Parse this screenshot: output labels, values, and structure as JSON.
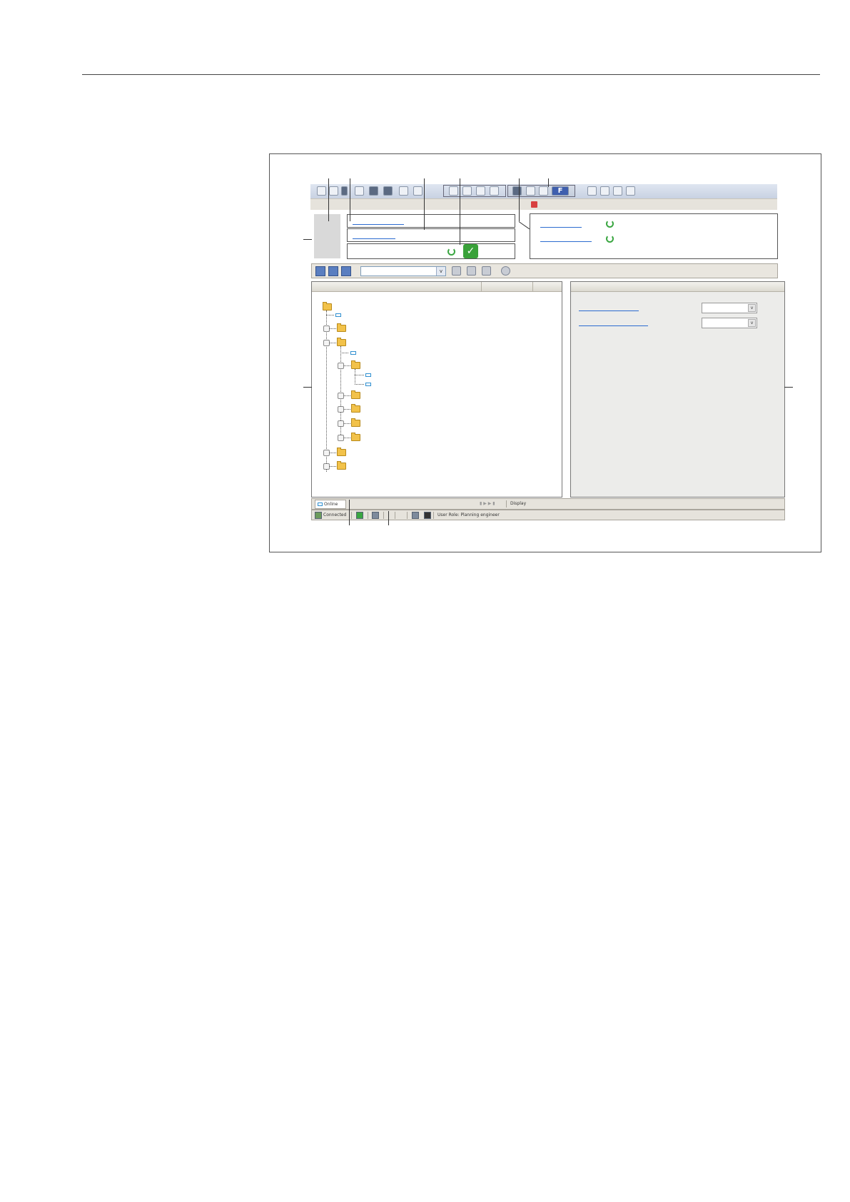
{
  "figure": {
    "tab_online": "Online",
    "status_connected": "Connected",
    "status_user_role": "User Role: Planning engineer",
    "tab_display": "Display",
    "toolbar_function_button": "F",
    "combo_arrow": "v"
  },
  "icons": [
    "new-file-icon",
    "open-folder-icon",
    "save-icon",
    "print-icon",
    "device-icon",
    "connect-icon",
    "properties-icon",
    "list-icon",
    "refresh-icon",
    "check-icon",
    "folder-icon",
    "device-leaf-icon"
  ],
  "colors": {
    "link": "#2c6bd0",
    "folder": "#f2c24a",
    "ok": "#3aa13a",
    "error": "#d84040"
  }
}
